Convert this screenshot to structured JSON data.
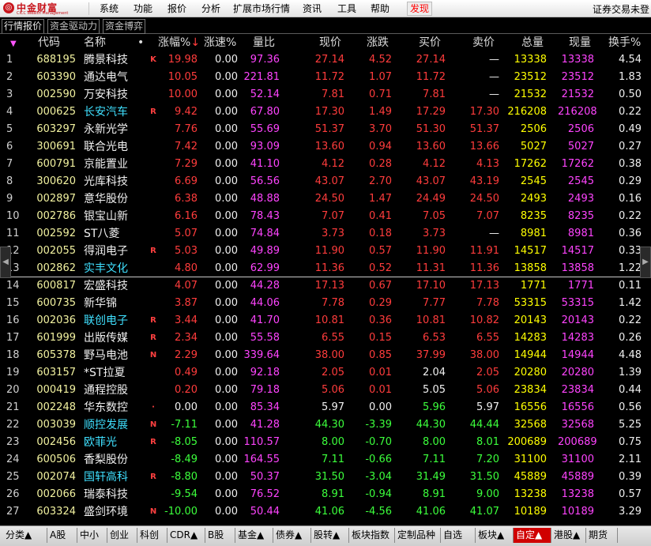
{
  "menubar": {
    "logo_text": "中金财富",
    "logo_sub": "CICC Wealth Management",
    "items": [
      {
        "label": "系统"
      },
      {
        "label": "功能"
      },
      {
        "label": "报价"
      },
      {
        "label": "分析"
      },
      {
        "label": "扩展市场行情"
      },
      {
        "label": "资讯"
      },
      {
        "label": "工具"
      },
      {
        "label": "帮助"
      },
      {
        "label": "发现"
      }
    ],
    "status": "证券交易未登"
  },
  "subtabs": [
    {
      "label": "行情报价"
    },
    {
      "label": "资金驱动力"
    },
    {
      "label": "资金博弈"
    }
  ],
  "header": {
    "code": "代码",
    "name": "名称",
    "dot": "•",
    "pct": "涨幅%",
    "pct_sort": "↓",
    "speed": "涨速%",
    "volratio": "量比",
    "price": "现价",
    "change": "涨跌",
    "bid": "买价",
    "ask": "卖价",
    "volume": "总量",
    "curvol": "现量",
    "turnover": "换手%"
  },
  "rows": [
    {
      "idx": "1",
      "code": "688195",
      "name": "腾景科技",
      "name_color": "white",
      "flag": "K",
      "pct": "19.98",
      "dir": "up",
      "speed": "0.00",
      "vr": "97.36",
      "price": "27.14",
      "change": "4.52",
      "bid": "27.14",
      "ask": "—",
      "vol": "13338",
      "cvol": "13338",
      "turn": "4.54"
    },
    {
      "idx": "2",
      "code": "603390",
      "name": "通达电气",
      "name_color": "white",
      "flag": "",
      "pct": "10.05",
      "dir": "up",
      "speed": "0.00",
      "vr": "221.81",
      "price": "11.72",
      "change": "1.07",
      "bid": "11.72",
      "ask": "—",
      "vol": "23512",
      "cvol": "23512",
      "turn": "1.83"
    },
    {
      "idx": "3",
      "code": "002590",
      "name": "万安科技",
      "name_color": "white",
      "flag": "",
      "pct": "10.00",
      "dir": "up",
      "speed": "0.00",
      "vr": "52.14",
      "price": "7.81",
      "change": "0.71",
      "bid": "7.81",
      "ask": "—",
      "vol": "21532",
      "cvol": "21532",
      "turn": "0.50"
    },
    {
      "idx": "4",
      "code": "000625",
      "name": "长安汽车",
      "name_color": "blue",
      "flag": "R",
      "pct": "9.42",
      "dir": "up",
      "speed": "0.00",
      "vr": "67.80",
      "price": "17.30",
      "change": "1.49",
      "bid": "17.29",
      "ask": "17.30",
      "vol": "216208",
      "cvol": "216208",
      "turn": "0.22"
    },
    {
      "idx": "5",
      "code": "603297",
      "name": "永新光学",
      "name_color": "white",
      "flag": "",
      "pct": "7.76",
      "dir": "up",
      "speed": "0.00",
      "vr": "55.69",
      "price": "51.37",
      "change": "3.70",
      "bid": "51.30",
      "ask": "51.37",
      "vol": "2506",
      "cvol": "2506",
      "turn": "0.49"
    },
    {
      "idx": "6",
      "code": "300691",
      "name": "联合光电",
      "name_color": "white",
      "flag": "",
      "pct": "7.42",
      "dir": "up",
      "speed": "0.00",
      "vr": "93.09",
      "price": "13.60",
      "change": "0.94",
      "bid": "13.60",
      "ask": "13.66",
      "vol": "5027",
      "cvol": "5027",
      "turn": "0.27"
    },
    {
      "idx": "7",
      "code": "600791",
      "name": "京能置业",
      "name_color": "white",
      "flag": "",
      "pct": "7.29",
      "dir": "up",
      "speed": "0.00",
      "vr": "41.10",
      "price": "4.12",
      "change": "0.28",
      "bid": "4.12",
      "ask": "4.13",
      "vol": "17262",
      "cvol": "17262",
      "turn": "0.38"
    },
    {
      "idx": "8",
      "code": "300620",
      "name": "光库科技",
      "name_color": "white",
      "flag": "",
      "pct": "6.69",
      "dir": "up",
      "speed": "0.00",
      "vr": "56.56",
      "price": "43.07",
      "change": "2.70",
      "bid": "43.07",
      "ask": "43.19",
      "vol": "2545",
      "cvol": "2545",
      "turn": "0.29"
    },
    {
      "idx": "9",
      "code": "002897",
      "name": "意华股份",
      "name_color": "white",
      "flag": "",
      "pct": "6.38",
      "dir": "up",
      "speed": "0.00",
      "vr": "48.88",
      "price": "24.50",
      "change": "1.47",
      "bid": "24.49",
      "ask": "24.50",
      "vol": "2493",
      "cvol": "2493",
      "turn": "0.16"
    },
    {
      "idx": "10",
      "code": "002786",
      "name": "银宝山新",
      "name_color": "white",
      "flag": "",
      "pct": "6.16",
      "dir": "up",
      "speed": "0.00",
      "vr": "78.43",
      "price": "7.07",
      "change": "0.41",
      "bid": "7.05",
      "ask": "7.07",
      "vol": "8235",
      "cvol": "8235",
      "turn": "0.22"
    },
    {
      "idx": "11",
      "code": "002592",
      "name": "ST八菱",
      "name_color": "white",
      "flag": "",
      "pct": "5.07",
      "dir": "up",
      "speed": "0.00",
      "vr": "74.84",
      "price": "3.73",
      "change": "0.18",
      "bid": "3.73",
      "ask": "—",
      "vol": "8981",
      "cvol": "8981",
      "turn": "0.36"
    },
    {
      "idx": "12",
      "code": "002055",
      "name": "得润电子",
      "name_color": "white",
      "flag": "R",
      "pct": "5.03",
      "dir": "up",
      "speed": "0.00",
      "vr": "49.89",
      "price": "11.90",
      "change": "0.57",
      "bid": "11.90",
      "ask": "11.91",
      "vol": "14517",
      "cvol": "14517",
      "turn": "0.33"
    },
    {
      "idx": "13",
      "code": "002862",
      "name": "实丰文化",
      "name_color": "blue",
      "flag": "",
      "pct": "4.80",
      "dir": "up",
      "speed": "0.00",
      "vr": "62.99",
      "price": "11.36",
      "change": "0.52",
      "bid": "11.31",
      "ask": "11.36",
      "vol": "13858",
      "cvol": "13858",
      "turn": "1.22",
      "selected": true
    },
    {
      "idx": "14",
      "code": "600817",
      "name": "宏盛科技",
      "name_color": "white",
      "flag": "",
      "pct": "4.07",
      "dir": "up",
      "speed": "0.00",
      "vr": "44.28",
      "price": "17.13",
      "change": "0.67",
      "bid": "17.10",
      "ask": "17.13",
      "vol": "1771",
      "cvol": "1771",
      "turn": "0.11"
    },
    {
      "idx": "15",
      "code": "600735",
      "name": "新华锦",
      "name_color": "white",
      "flag": "",
      "pct": "3.87",
      "dir": "up",
      "speed": "0.00",
      "vr": "44.06",
      "price": "7.78",
      "change": "0.29",
      "bid": "7.77",
      "ask": "7.78",
      "vol": "53315",
      "cvol": "53315",
      "turn": "1.42"
    },
    {
      "idx": "16",
      "code": "002036",
      "name": "联创电子",
      "name_color": "blue",
      "flag": "R",
      "pct": "3.44",
      "dir": "up",
      "speed": "0.00",
      "vr": "41.70",
      "price": "10.81",
      "change": "0.36",
      "bid": "10.81",
      "ask": "10.82",
      "vol": "20143",
      "cvol": "20143",
      "turn": "0.22"
    },
    {
      "idx": "17",
      "code": "601999",
      "name": "出版传媒",
      "name_color": "white",
      "flag": "R",
      "pct": "2.34",
      "dir": "up",
      "speed": "0.00",
      "vr": "55.58",
      "price": "6.55",
      "change": "0.15",
      "bid": "6.53",
      "ask": "6.55",
      "vol": "14283",
      "cvol": "14283",
      "turn": "0.26"
    },
    {
      "idx": "18",
      "code": "605378",
      "name": "野马电池",
      "name_color": "white",
      "flag": "N",
      "pct": "2.29",
      "dir": "up",
      "speed": "0.00",
      "vr": "339.64",
      "price": "38.00",
      "change": "0.85",
      "bid": "37.99",
      "ask": "38.00",
      "vol": "14944",
      "cvol": "14944",
      "turn": "4.48"
    },
    {
      "idx": "19",
      "code": "603157",
      "name": "*ST拉夏",
      "name_color": "white",
      "flag": "",
      "pct": "0.49",
      "dir": "up",
      "speed": "0.00",
      "vr": "92.18",
      "price": "2.05",
      "change": "0.01",
      "bid": "2.04",
      "bid_dir": "flat",
      "ask": "2.05",
      "vol": "20280",
      "cvol": "20280",
      "turn": "1.39"
    },
    {
      "idx": "20",
      "code": "000419",
      "name": "通程控股",
      "name_color": "white",
      "flag": "",
      "pct": "0.20",
      "dir": "up",
      "speed": "0.00",
      "vr": "79.18",
      "price": "5.06",
      "change": "0.01",
      "bid": "5.05",
      "bid_dir": "flat",
      "ask": "5.06",
      "vol": "23834",
      "cvol": "23834",
      "turn": "0.44"
    },
    {
      "idx": "21",
      "code": "002248",
      "name": "华东数控",
      "name_color": "white",
      "flag": "·",
      "pct": "0.00",
      "dir": "flat",
      "speed": "0.00",
      "vr": "85.34",
      "price": "5.97",
      "change": "0.00",
      "bid": "5.96",
      "bid_dir": "down",
      "ask": "5.97",
      "vol": "16556",
      "cvol": "16556",
      "turn": "0.56"
    },
    {
      "idx": "22",
      "code": "003039",
      "name": "顺控发展",
      "name_color": "blue",
      "flag": "N",
      "pct": "-7.11",
      "dir": "down",
      "speed": "0.00",
      "vr": "41.28",
      "price": "44.30",
      "change": "-3.39",
      "bid": "44.30",
      "ask": "44.44",
      "vol": "32568",
      "cvol": "32568",
      "turn": "5.25"
    },
    {
      "idx": "23",
      "code": "002456",
      "name": "欧菲光",
      "name_color": "blue",
      "flag": "R",
      "pct": "-8.05",
      "dir": "down",
      "speed": "0.00",
      "vr": "110.57",
      "price": "8.00",
      "change": "-0.70",
      "bid": "8.00",
      "ask": "8.01",
      "vol": "200689",
      "cvol": "200689",
      "turn": "0.75"
    },
    {
      "idx": "24",
      "code": "600506",
      "name": "香梨股份",
      "name_color": "white",
      "flag": "",
      "pct": "-8.49",
      "dir": "down",
      "speed": "0.00",
      "vr": "164.55",
      "price": "7.11",
      "change": "-0.66",
      "bid": "7.11",
      "ask": "7.20",
      "vol": "31100",
      "cvol": "31100",
      "turn": "2.11"
    },
    {
      "idx": "25",
      "code": "002074",
      "name": "国轩高科",
      "name_color": "blue",
      "flag": "R",
      "pct": "-8.80",
      "dir": "down",
      "speed": "0.00",
      "vr": "50.37",
      "price": "31.50",
      "change": "-3.04",
      "bid": "31.49",
      "ask": "31.50",
      "vol": "45889",
      "cvol": "45889",
      "turn": "0.39"
    },
    {
      "idx": "26",
      "code": "002066",
      "name": "瑞泰科技",
      "name_color": "white",
      "flag": "",
      "pct": "-9.54",
      "dir": "down",
      "speed": "0.00",
      "vr": "76.52",
      "price": "8.91",
      "change": "-0.94",
      "bid": "8.91",
      "ask": "9.00",
      "vol": "13238",
      "cvol": "13238",
      "turn": "0.57"
    },
    {
      "idx": "27",
      "code": "603324",
      "name": "盛剑环境",
      "name_color": "white",
      "flag": "N",
      "pct": "-10.00",
      "dir": "down",
      "speed": "0.00",
      "vr": "50.44",
      "price": "41.06",
      "change": "-4.56",
      "bid": "41.06",
      "ask": "41.07",
      "vol": "10189",
      "cvol": "10189",
      "turn": "3.29"
    }
  ],
  "bottom_tabs": [
    {
      "label": "分类▲"
    },
    {
      "label": "A股"
    },
    {
      "label": "中小"
    },
    {
      "label": "创业"
    },
    {
      "label": "科创"
    },
    {
      "label": "CDR▲"
    },
    {
      "label": "B股"
    },
    {
      "label": "基金▲"
    },
    {
      "label": "债券▲"
    },
    {
      "label": "股转▲"
    },
    {
      "label": "板块指数"
    },
    {
      "label": "定制品种"
    },
    {
      "label": "自选"
    },
    {
      "label": "板块▲"
    },
    {
      "label": "自定▲"
    },
    {
      "label": "港股▲"
    },
    {
      "label": "期货"
    }
  ],
  "colors": {
    "up": "#ff3c3c",
    "down": "#3cff3c",
    "code": "#f2f2a0",
    "name_blue": "#3fe0ff",
    "volume": "#ffff00",
    "current_volume": "#ff44ff",
    "active_bottom_tab": "#d00000"
  }
}
